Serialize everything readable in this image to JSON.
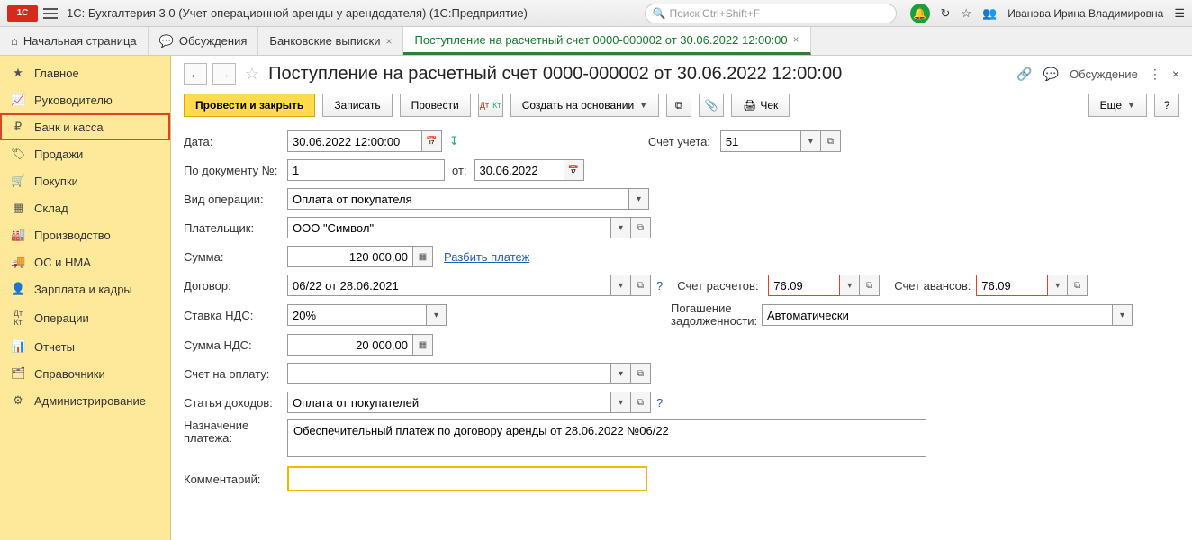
{
  "app": {
    "title": "1С: Бухгалтерия 3.0 (Учет операционной аренды у арендодателя)  (1С:Предприятие)",
    "search_ph": "Поиск Ctrl+Shift+F",
    "user": "Иванова Ирина Владимировна"
  },
  "tabs": {
    "home": "Начальная страница",
    "discuss": "Обсуждения",
    "bank": "Банковские выписки",
    "active": "Поступление на расчетный счет 0000-000002 от 30.06.2022 12:00:00"
  },
  "sidebar": {
    "items": [
      "Главное",
      "Руководителю",
      "Банк и касса",
      "Продажи",
      "Покупки",
      "Склад",
      "Производство",
      "ОС и НМА",
      "Зарплата и кадры",
      "Операции",
      "Отчеты",
      "Справочники",
      "Администрирование"
    ]
  },
  "page": {
    "title": "Поступление на расчетный счет 0000-000002 от 30.06.2022 12:00:00",
    "discuss": "Обсуждение"
  },
  "toolbar": {
    "post_close": "Провести и закрыть",
    "save": "Записать",
    "post": "Провести",
    "cob": "Создать на основании",
    "check": "Чек",
    "more": "Еще"
  },
  "form": {
    "date_l": "Дата:",
    "date_v": "30.06.2022 12:00:00",
    "acc_l": "Счет учета:",
    "acc_v": "51",
    "docnum_l": "По документу №:",
    "docnum_v": "1",
    "from_l": "от:",
    "from_v": "30.06.2022",
    "optype_l": "Вид операции:",
    "optype_v": "Оплата от покупателя",
    "payer_l": "Плательщик:",
    "payer_v": "ООО \"Символ\"",
    "sum_l": "Сумма:",
    "sum_v": "120 000,00",
    "split": "Разбить платеж",
    "contract_l": "Договор:",
    "contract_v": "06/22 от 28.06.2021",
    "acc_calc_l": "Счет расчетов:",
    "acc_calc_v": "76.09",
    "acc_adv_l": "Счет авансов:",
    "acc_adv_v": "76.09",
    "vat_l": "Ставка НДС:",
    "vat_v": "20%",
    "debt_l": "Погашение задолженности:",
    "debt_v": "Автоматически",
    "vatsum_l": "Сумма НДС:",
    "vatsum_v": "20 000,00",
    "invoice_l": "Счет на оплату:",
    "invoice_v": "",
    "income_l": "Статья доходов:",
    "income_v": "Оплата от покупателей",
    "purpose_l": "Назначение платежа:",
    "purpose_v": "Обеспечительный платеж по договору аренды от 28.06.2022 №06/22",
    "comment_l": "Комментарий:",
    "comment_v": ""
  }
}
